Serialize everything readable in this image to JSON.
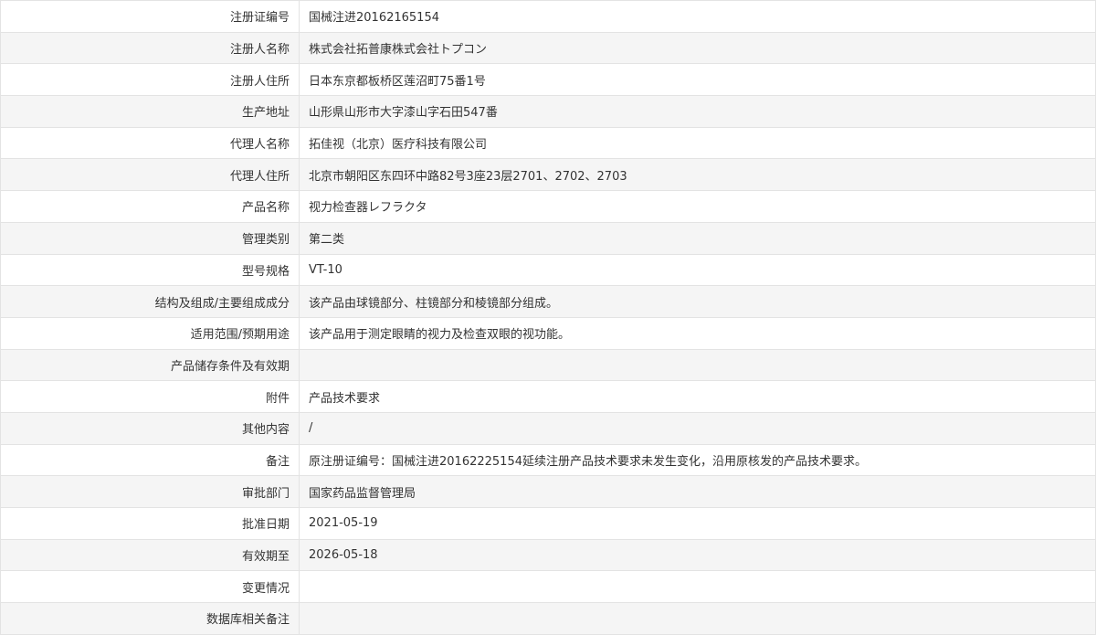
{
  "rows": [
    {
      "label": "注册证编号",
      "value": "国械注进20162165154"
    },
    {
      "label": "注册人名称",
      "value": "株式会社拓普康株式会社トプコン"
    },
    {
      "label": "注册人住所",
      "value": "日本东京都板桥区莲沼町75番1号"
    },
    {
      "label": "生产地址",
      "value": "山形県山形市大字漆山字石田547番"
    },
    {
      "label": "代理人名称",
      "value": "拓佳视（北京）医疗科技有限公司"
    },
    {
      "label": "代理人住所",
      "value": "北京市朝阳区东四环中路82号3座23层2701、2702、2703"
    },
    {
      "label": "产品名称",
      "value": "视力检查器レフラクタ"
    },
    {
      "label": "管理类别",
      "value": "第二类"
    },
    {
      "label": "型号规格",
      "value": "VT-10"
    },
    {
      "label": "结构及组成/主要组成成分",
      "value": "该产品由球镜部分、柱镜部分和棱镜部分组成。"
    },
    {
      "label": "适用范围/预期用途",
      "value": "该产品用于测定眼睛的视力及检查双眼的视功能。"
    },
    {
      "label": "产品储存条件及有效期",
      "value": ""
    },
    {
      "label": "附件",
      "value": "产品技术要求"
    },
    {
      "label": "其他内容",
      "value": "/"
    },
    {
      "label": "备注",
      "value": "原注册证编号：国械注进20162225154延续注册产品技术要求未发生变化，沿用原核发的产品技术要求。"
    },
    {
      "label": "审批部门",
      "value": "国家药品监督管理局"
    },
    {
      "label": "批准日期",
      "value": "2021-05-19"
    },
    {
      "label": "有效期至",
      "value": "2026-05-18"
    },
    {
      "label": "变更情况",
      "value": ""
    },
    {
      "label": "数据库相关备注",
      "value": ""
    }
  ]
}
